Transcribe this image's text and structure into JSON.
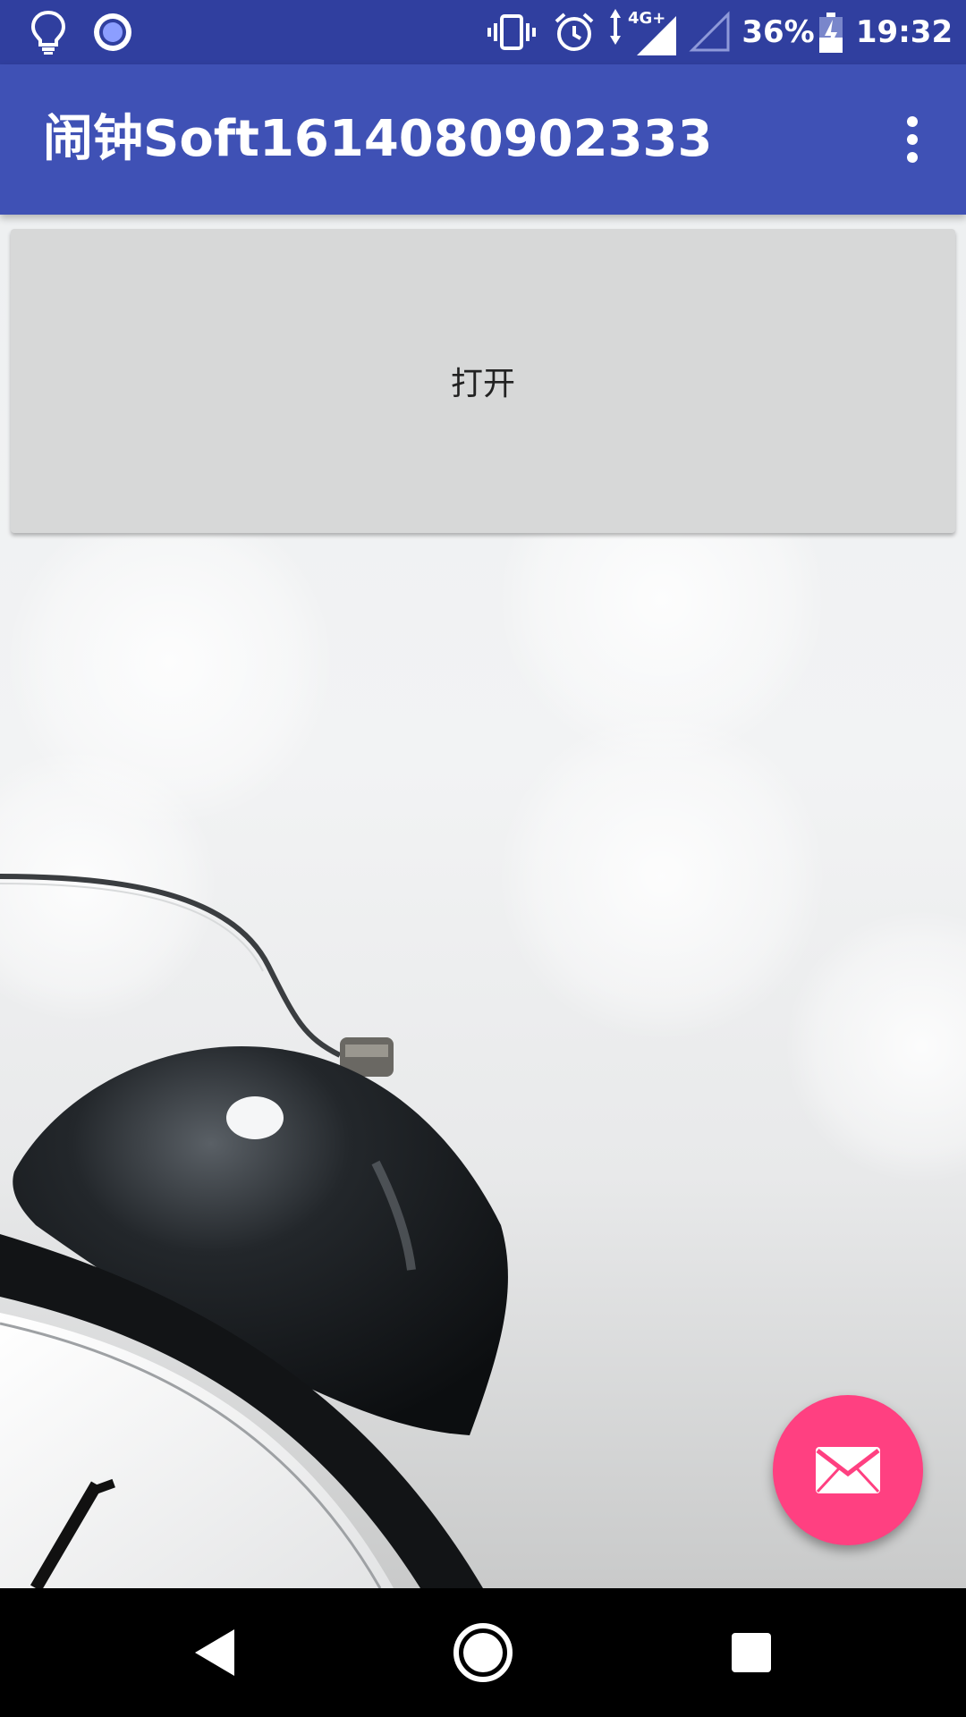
{
  "status_bar": {
    "battery_percent": "36%",
    "time": "19:32",
    "network_type": "4G+",
    "icons": [
      "lightbulb-icon",
      "radio-record-icon",
      "vibrate-icon",
      "alarm-icon",
      "signal-icon",
      "no-signal-icon",
      "battery-icon"
    ]
  },
  "app_bar": {
    "title": "闹钟Soft1614080902333",
    "menu_icon": "more-vert-icon"
  },
  "main": {
    "open_button_label": "打开",
    "background": "alarm-clock-photo"
  },
  "fab": {
    "icon": "email-icon",
    "color": "#FF4081"
  },
  "nav_bar": {
    "buttons": [
      "back-icon",
      "home-icon",
      "recents-icon"
    ]
  },
  "colors": {
    "status_bar": "#303F9F",
    "app_bar": "#3F51B5",
    "accent": "#FF4081"
  }
}
